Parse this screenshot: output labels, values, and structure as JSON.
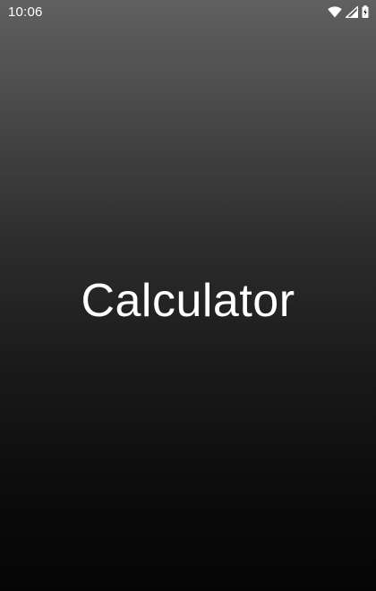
{
  "status_bar": {
    "time": "10:06",
    "icons": [
      "wifi-icon",
      "cellular-signal-icon",
      "battery-icon"
    ]
  },
  "splash": {
    "title": "Calculator"
  },
  "colors": {
    "background_top": "#606060",
    "background_bottom": "#050505",
    "text": "#ffffff"
  }
}
